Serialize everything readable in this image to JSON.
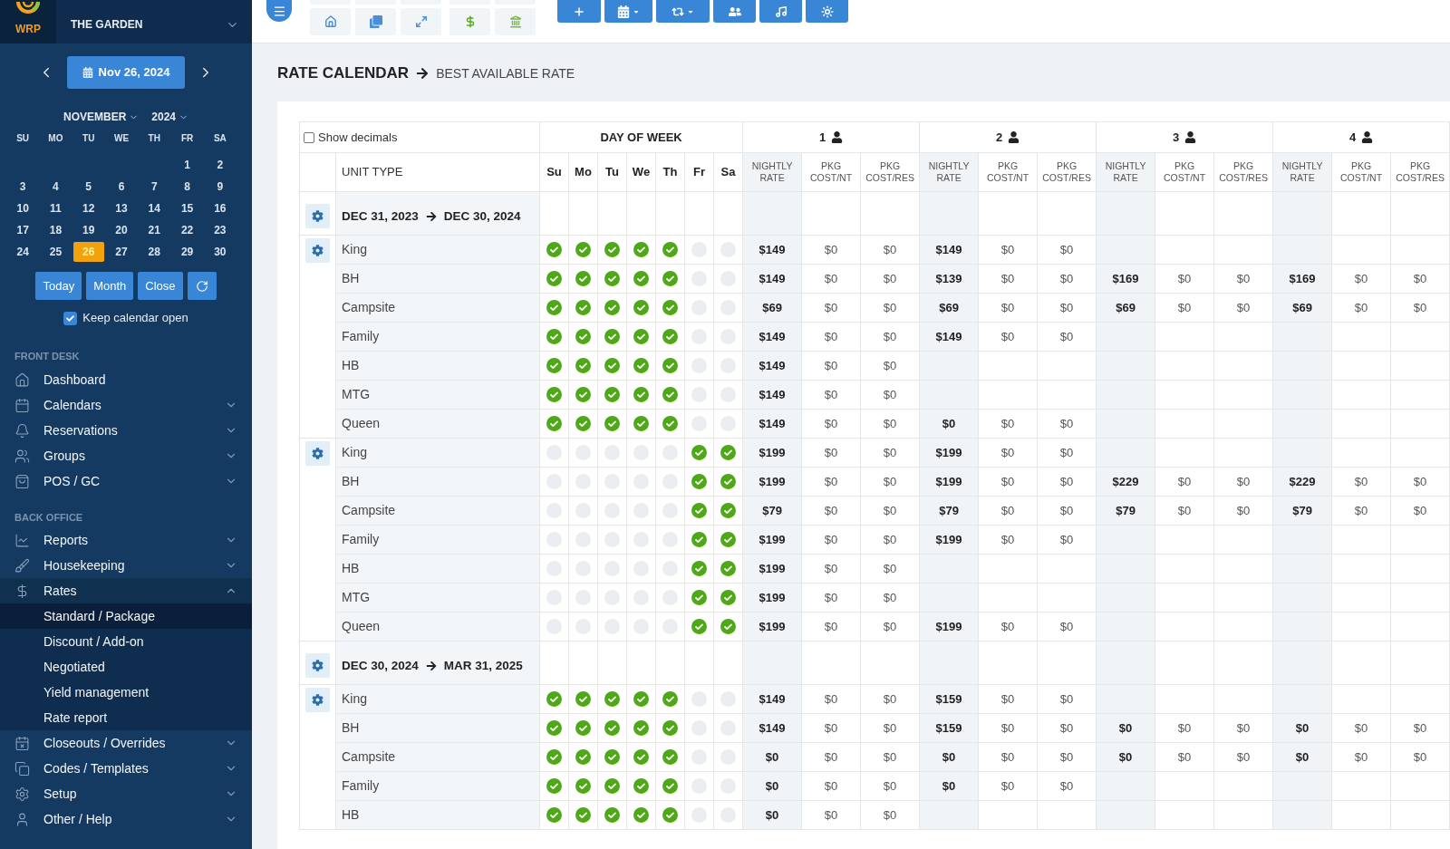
{
  "sidebar": {
    "logo": "WRP",
    "property": "THE GARDEN",
    "date_picker": {
      "date": "Nov 26, 2024",
      "month": "NOVEMBER",
      "year": "2024",
      "weekdays": [
        "SU",
        "MO",
        "TU",
        "WE",
        "TH",
        "FR",
        "SA"
      ],
      "weeks": [
        [
          {
            "day": "1",
            "selected": false
          },
          {
            "day": "2",
            "selected": false
          }
        ],
        [
          {
            "day": "3",
            "selected": false
          },
          {
            "day": "4",
            "selected": false
          },
          {
            "day": "5",
            "selected": false
          },
          {
            "day": "6",
            "selected": false
          },
          {
            "day": "7",
            "selected": false
          },
          {
            "day": "8",
            "selected": false
          },
          {
            "day": "9",
            "selected": false
          }
        ],
        [
          {
            "day": "10",
            "selected": false
          },
          {
            "day": "11",
            "selected": false
          },
          {
            "day": "12",
            "selected": false
          },
          {
            "day": "13",
            "selected": false
          },
          {
            "day": "14",
            "selected": false
          },
          {
            "day": "15",
            "selected": false
          },
          {
            "day": "16",
            "selected": false
          }
        ],
        [
          {
            "day": "17",
            "selected": false
          },
          {
            "day": "18",
            "selected": false
          },
          {
            "day": "19",
            "selected": false
          },
          {
            "day": "20",
            "selected": false
          },
          {
            "day": "21",
            "selected": false
          },
          {
            "day": "22",
            "selected": false
          },
          {
            "day": "23",
            "selected": false
          }
        ],
        [
          {
            "day": "24",
            "selected": false
          },
          {
            "day": "25",
            "selected": false
          },
          {
            "day": "26",
            "selected": true
          },
          {
            "day": "27",
            "selected": false
          },
          {
            "day": "28",
            "selected": false
          },
          {
            "day": "29",
            "selected": false
          },
          {
            "day": "30",
            "selected": false
          }
        ]
      ],
      "buttons": [
        "Today",
        "Month",
        "Close"
      ],
      "keep_open": {
        "label": "Keep calendar open",
        "checked": true
      }
    },
    "nav": [
      {
        "heading": "FRONT DESK",
        "items": [
          {
            "label": "Dashboard"
          },
          {
            "label": "Calendars",
            "expanded": false
          },
          {
            "label": "Reservations",
            "expanded": false
          },
          {
            "label": "Groups",
            "expanded": false
          },
          {
            "label": "POS / GC",
            "expanded": false
          }
        ]
      },
      {
        "heading": "BACK OFFICE",
        "items": [
          {
            "label": "Reports",
            "expanded": false
          },
          {
            "label": "Housekeeping",
            "expanded": false
          },
          {
            "label": "Rates",
            "expanded": true,
            "children": [
              {
                "label": "Standard / Package",
                "selected": true
              },
              {
                "label": "Discount / Add-on",
                "selected": false
              },
              {
                "label": "Negotiated",
                "selected": false
              },
              {
                "label": "Yield management",
                "selected": false
              },
              {
                "label": "Rate report",
                "selected": false
              }
            ]
          },
          {
            "label": "Closeouts / Overrides",
            "expanded": false
          },
          {
            "label": "Codes / Templates",
            "expanded": false
          },
          {
            "label": "Setup",
            "expanded": false
          },
          {
            "label": "Other / Help",
            "expanded": false
          }
        ]
      }
    ]
  },
  "page": {
    "title": "RATE CALENDAR",
    "subtitle": "BEST AVAILABLE RATE"
  },
  "table": {
    "show_decimals": {
      "label": "Show decimals",
      "checked": false
    },
    "day_heading": "DAY OF WEEK",
    "unit_heading": "UNIT TYPE",
    "days": [
      "Su",
      "Mo",
      "Tu",
      "We",
      "Th",
      "Fr",
      "Sa"
    ],
    "occupancy": [
      {
        "label": "1",
        "columns": [
          "NIGHTLY RATE",
          "PKG COST/NT",
          "PKG COST/RES"
        ]
      },
      {
        "label": "2",
        "columns": [
          "NIGHTLY RATE",
          "PKG COST/NT",
          "PKG COST/RES"
        ]
      },
      {
        "label": "3",
        "columns": [
          "NIGHTLY RATE",
          "PKG COST/NT",
          "PKG COST/RES"
        ]
      },
      {
        "label": "4",
        "columns": [
          "NIGHTLY RATE",
          "PKG COST/NT",
          "PKG COST/RES"
        ]
      }
    ],
    "sections": [
      {
        "start": "DEC 31, 2023",
        "end": "DEC 30, 2024",
        "groups": [
          {
            "rows": [
              {
                "unit": "King",
                "days": [
                  {
                    "on": true
                  },
                  {
                    "on": true
                  },
                  {
                    "on": true
                  },
                  {
                    "on": true
                  },
                  {
                    "on": true
                  },
                  {
                    "on": false
                  },
                  {
                    "on": false
                  }
                ],
                "rates": [
                  [
                    "$149",
                    "$0",
                    "$0"
                  ],
                  [
                    "$149",
                    "$0",
                    "$0"
                  ]
                ]
              },
              {
                "unit": "BH",
                "days": [
                  {
                    "on": true
                  },
                  {
                    "on": true
                  },
                  {
                    "on": true
                  },
                  {
                    "on": true
                  },
                  {
                    "on": true
                  },
                  {
                    "on": false
                  },
                  {
                    "on": false
                  }
                ],
                "rates": [
                  [
                    "$149",
                    "$0",
                    "$0"
                  ],
                  [
                    "$139",
                    "$0",
                    "$0"
                  ],
                  [
                    "$169",
                    "$0",
                    "$0"
                  ],
                  [
                    "$169",
                    "$0",
                    "$0"
                  ]
                ]
              },
              {
                "unit": "Campsite",
                "days": [
                  {
                    "on": true
                  },
                  {
                    "on": true
                  },
                  {
                    "on": true
                  },
                  {
                    "on": true
                  },
                  {
                    "on": true
                  },
                  {
                    "on": false
                  },
                  {
                    "on": false
                  }
                ],
                "rates": [
                  [
                    "$69",
                    "$0",
                    "$0"
                  ],
                  [
                    "$69",
                    "$0",
                    "$0"
                  ],
                  [
                    "$69",
                    "$0",
                    "$0"
                  ],
                  [
                    "$69",
                    "$0",
                    "$0"
                  ]
                ]
              },
              {
                "unit": "Family",
                "days": [
                  {
                    "on": true
                  },
                  {
                    "on": true
                  },
                  {
                    "on": true
                  },
                  {
                    "on": true
                  },
                  {
                    "on": true
                  },
                  {
                    "on": false
                  },
                  {
                    "on": false
                  }
                ],
                "rates": [
                  [
                    "$149",
                    "$0",
                    "$0"
                  ],
                  [
                    "$149",
                    "$0",
                    "$0"
                  ]
                ]
              },
              {
                "unit": "HB",
                "days": [
                  {
                    "on": true
                  },
                  {
                    "on": true
                  },
                  {
                    "on": true
                  },
                  {
                    "on": true
                  },
                  {
                    "on": true
                  },
                  {
                    "on": false
                  },
                  {
                    "on": false
                  }
                ],
                "rates": [
                  [
                    "$149",
                    "$0",
                    "$0"
                  ]
                ]
              },
              {
                "unit": "MTG",
                "days": [
                  {
                    "on": true
                  },
                  {
                    "on": true
                  },
                  {
                    "on": true
                  },
                  {
                    "on": true
                  },
                  {
                    "on": true
                  },
                  {
                    "on": false
                  },
                  {
                    "on": false
                  }
                ],
                "rates": [
                  [
                    "$149",
                    "$0",
                    "$0"
                  ]
                ]
              },
              {
                "unit": "Queen",
                "days": [
                  {
                    "on": true
                  },
                  {
                    "on": true
                  },
                  {
                    "on": true
                  },
                  {
                    "on": true
                  },
                  {
                    "on": true
                  },
                  {
                    "on": false
                  },
                  {
                    "on": false
                  }
                ],
                "rates": [
                  [
                    "$149",
                    "$0",
                    "$0"
                  ],
                  [
                    "$0",
                    "$0",
                    "$0"
                  ]
                ]
              }
            ]
          },
          {
            "rows": [
              {
                "unit": "King",
                "days": [
                  {
                    "on": false
                  },
                  {
                    "on": false
                  },
                  {
                    "on": false
                  },
                  {
                    "on": false
                  },
                  {
                    "on": false
                  },
                  {
                    "on": true
                  },
                  {
                    "on": true
                  }
                ],
                "rates": [
                  [
                    "$199",
                    "$0",
                    "$0"
                  ],
                  [
                    "$199",
                    "$0",
                    "$0"
                  ]
                ]
              },
              {
                "unit": "BH",
                "days": [
                  {
                    "on": false
                  },
                  {
                    "on": false
                  },
                  {
                    "on": false
                  },
                  {
                    "on": false
                  },
                  {
                    "on": false
                  },
                  {
                    "on": true
                  },
                  {
                    "on": true
                  }
                ],
                "rates": [
                  [
                    "$199",
                    "$0",
                    "$0"
                  ],
                  [
                    "$199",
                    "$0",
                    "$0"
                  ],
                  [
                    "$229",
                    "$0",
                    "$0"
                  ],
                  [
                    "$229",
                    "$0",
                    "$0"
                  ]
                ]
              },
              {
                "unit": "Campsite",
                "days": [
                  {
                    "on": false
                  },
                  {
                    "on": false
                  },
                  {
                    "on": false
                  },
                  {
                    "on": false
                  },
                  {
                    "on": false
                  },
                  {
                    "on": true
                  },
                  {
                    "on": true
                  }
                ],
                "rates": [
                  [
                    "$79",
                    "$0",
                    "$0"
                  ],
                  [
                    "$79",
                    "$0",
                    "$0"
                  ],
                  [
                    "$79",
                    "$0",
                    "$0"
                  ],
                  [
                    "$79",
                    "$0",
                    "$0"
                  ]
                ]
              },
              {
                "unit": "Family",
                "days": [
                  {
                    "on": false
                  },
                  {
                    "on": false
                  },
                  {
                    "on": false
                  },
                  {
                    "on": false
                  },
                  {
                    "on": false
                  },
                  {
                    "on": true
                  },
                  {
                    "on": true
                  }
                ],
                "rates": [
                  [
                    "$199",
                    "$0",
                    "$0"
                  ],
                  [
                    "$199",
                    "$0",
                    "$0"
                  ]
                ]
              },
              {
                "unit": "HB",
                "days": [
                  {
                    "on": false
                  },
                  {
                    "on": false
                  },
                  {
                    "on": false
                  },
                  {
                    "on": false
                  },
                  {
                    "on": false
                  },
                  {
                    "on": true
                  },
                  {
                    "on": true
                  }
                ],
                "rates": [
                  [
                    "$199",
                    "$0",
                    "$0"
                  ]
                ]
              },
              {
                "unit": "MTG",
                "days": [
                  {
                    "on": false
                  },
                  {
                    "on": false
                  },
                  {
                    "on": false
                  },
                  {
                    "on": false
                  },
                  {
                    "on": false
                  },
                  {
                    "on": true
                  },
                  {
                    "on": true
                  }
                ],
                "rates": [
                  [
                    "$199",
                    "$0",
                    "$0"
                  ]
                ]
              },
              {
                "unit": "Queen",
                "days": [
                  {
                    "on": false
                  },
                  {
                    "on": false
                  },
                  {
                    "on": false
                  },
                  {
                    "on": false
                  },
                  {
                    "on": false
                  },
                  {
                    "on": true
                  },
                  {
                    "on": true
                  }
                ],
                "rates": [
                  [
                    "$199",
                    "$0",
                    "$0"
                  ],
                  [
                    "$199",
                    "$0",
                    "$0"
                  ]
                ]
              }
            ]
          }
        ]
      },
      {
        "start": "DEC 30, 2024",
        "end": "MAR 31, 2025",
        "groups": [
          {
            "rows": [
              {
                "unit": "King",
                "days": [
                  {
                    "on": true
                  },
                  {
                    "on": true
                  },
                  {
                    "on": true
                  },
                  {
                    "on": true
                  },
                  {
                    "on": true
                  },
                  {
                    "on": false
                  },
                  {
                    "on": false
                  }
                ],
                "rates": [
                  [
                    "$149",
                    "$0",
                    "$0"
                  ],
                  [
                    "$159",
                    "$0",
                    "$0"
                  ]
                ]
              },
              {
                "unit": "BH",
                "days": [
                  {
                    "on": true
                  },
                  {
                    "on": true
                  },
                  {
                    "on": true
                  },
                  {
                    "on": true
                  },
                  {
                    "on": true
                  },
                  {
                    "on": false
                  },
                  {
                    "on": false
                  }
                ],
                "rates": [
                  [
                    "$149",
                    "$0",
                    "$0"
                  ],
                  [
                    "$159",
                    "$0",
                    "$0"
                  ],
                  [
                    "$0",
                    "$0",
                    "$0"
                  ],
                  [
                    "$0",
                    "$0",
                    "$0"
                  ]
                ]
              },
              {
                "unit": "Campsite",
                "days": [
                  {
                    "on": true
                  },
                  {
                    "on": true
                  },
                  {
                    "on": true
                  },
                  {
                    "on": true
                  },
                  {
                    "on": true
                  },
                  {
                    "on": false
                  },
                  {
                    "on": false
                  }
                ],
                "rates": [
                  [
                    "$0",
                    "$0",
                    "$0"
                  ],
                  [
                    "$0",
                    "$0",
                    "$0"
                  ],
                  [
                    "$0",
                    "$0",
                    "$0"
                  ],
                  [
                    "$0",
                    "$0",
                    "$0"
                  ]
                ]
              },
              {
                "unit": "Family",
                "days": [
                  {
                    "on": true
                  },
                  {
                    "on": true
                  },
                  {
                    "on": true
                  },
                  {
                    "on": true
                  },
                  {
                    "on": true
                  },
                  {
                    "on": false
                  },
                  {
                    "on": false
                  }
                ],
                "rates": [
                  [
                    "$0",
                    "$0",
                    "$0"
                  ],
                  [
                    "$0",
                    "$0",
                    "$0"
                  ]
                ]
              },
              {
                "unit": "HB",
                "days": [
                  {
                    "on": true
                  },
                  {
                    "on": true
                  },
                  {
                    "on": true
                  },
                  {
                    "on": true
                  },
                  {
                    "on": true
                  },
                  {
                    "on": false
                  },
                  {
                    "on": false
                  }
                ],
                "rates": [
                  [
                    "$0",
                    "$0",
                    "$0"
                  ]
                ]
              }
            ]
          }
        ]
      }
    ]
  }
}
